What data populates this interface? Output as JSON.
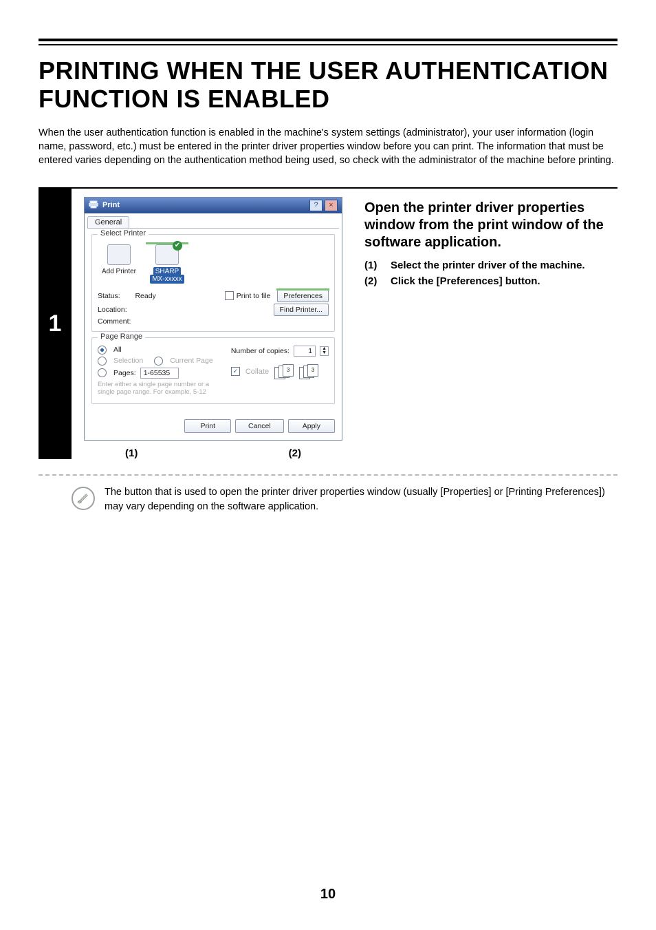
{
  "heading": "PRINTING WHEN THE USER AUTHENTICATION FUNCTION IS ENABLED",
  "lead": "When the user authentication function is enabled in the machine's system settings (administrator), your user information (login name, password, etc.) must be entered in the printer driver properties window before you can print. The information that must be entered varies depending on the authentication method being used, so check with the administrator of the machine before printing.",
  "step_number": "1",
  "dialog": {
    "title": "Print",
    "help_btn": "?",
    "close_btn": "×",
    "tab": "General",
    "select_printer_label": "Select Printer",
    "printers": {
      "add": "Add Printer",
      "sharp1": "SHARP",
      "sharp2": "MX-xxxxx"
    },
    "status_label": "Status:",
    "status_value": "Ready",
    "location_label": "Location:",
    "comment_label": "Comment:",
    "print_to_file": "Print to file",
    "preferences_btn": "Preferences",
    "find_printer_btn": "Find Printer...",
    "page_range_label": "Page Range",
    "all": "All",
    "selection": "Selection",
    "current_page": "Current Page",
    "pages": "Pages:",
    "pages_value": "1-65535",
    "hint": "Enter either a single page number or a single page range.  For example, 5-12",
    "copies_label": "Number of copies:",
    "copies_value": "1",
    "collate": "Collate",
    "print_btn": "Print",
    "cancel_btn": "Cancel",
    "apply_btn": "Apply"
  },
  "callout_labels": {
    "one": "(1)",
    "two": "(2)"
  },
  "instructions": {
    "title": "Open the printer driver properties window from the print window of the software application.",
    "items": [
      {
        "num": "(1)",
        "text": "Select the printer driver of the machine."
      },
      {
        "num": "(2)",
        "text": "Click the [Preferences] button."
      }
    ]
  },
  "note": "The button that is used to open the printer driver properties window (usually [Properties] or [Printing Preferences]) may vary depending on the software application.",
  "page_number": "10"
}
